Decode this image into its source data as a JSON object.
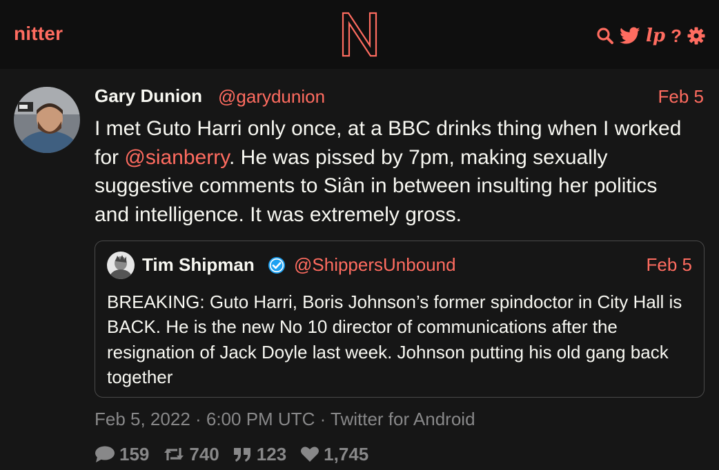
{
  "navbar": {
    "brand": "nitter",
    "logo_letter": "N",
    "icons": [
      "search-icon",
      "twitter-bird-icon",
      "lp-icon",
      "help-icon",
      "gear-icon"
    ],
    "lp_label": "lp",
    "help_label": "?"
  },
  "tweet": {
    "fullname": "Gary Dunion",
    "username": "@garydunion",
    "date": "Feb 5",
    "body": {
      "before": "I met Guto Harri only once, at a BBC drinks thing when I worked for ",
      "mention": "@sianberry",
      "after": ". He was pissed by 7pm, making sexually suggestive comments to Siân in between insulting her politics and intelligence. It was extremely gross."
    },
    "quote": {
      "fullname": "Tim Shipman",
      "verified": true,
      "username": "@ShippersUnbound",
      "date": "Feb 5",
      "text": "BREAKING: Guto Harri, Boris Johnson’s former spindoctor in City Hall is BACK. He is the new No 10 director of communications after the resignation of Jack Doyle last week. Johnson putting his old gang back together"
    },
    "published": "Feb 5, 2022 · 6:00 PM UTC · Twitter for Android",
    "stats": {
      "replies": "159",
      "retweets": "740",
      "quotes": "123",
      "likes": "1,745"
    }
  },
  "colors": {
    "accent": "#ff6c60",
    "background": "#161616",
    "navbar": "#0f0f0f",
    "text": "#f8f8f2",
    "muted": "#888889",
    "border": "#4a4a4a",
    "verified": "#1da1f2"
  }
}
